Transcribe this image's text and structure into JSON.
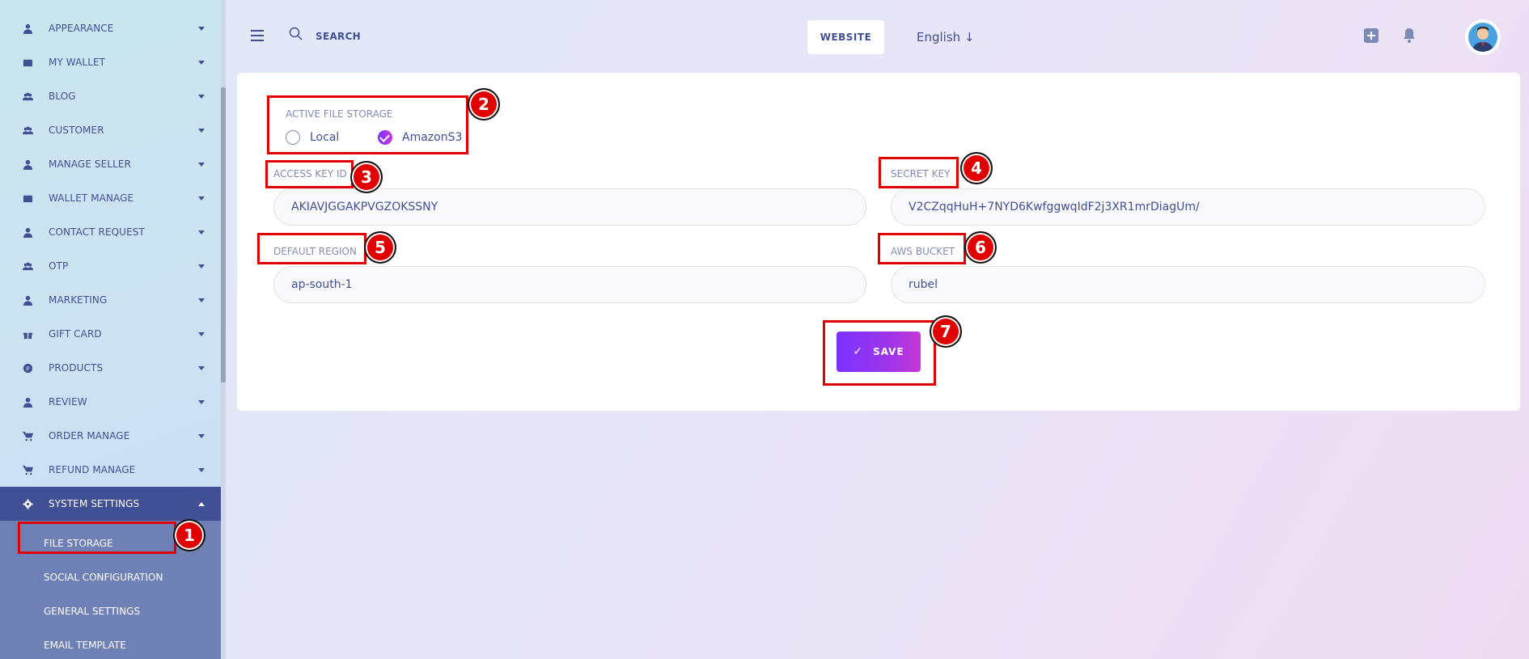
{
  "sidebar": {
    "items": [
      {
        "label": "APPEARANCE",
        "icon": "user-icon"
      },
      {
        "label": "MY WALLET",
        "icon": "wallet-icon"
      },
      {
        "label": "BLOG",
        "icon": "users-icon"
      },
      {
        "label": "CUSTOMER",
        "icon": "users-icon"
      },
      {
        "label": "MANAGE SELLER",
        "icon": "user-icon"
      },
      {
        "label": "WALLET MANAGE",
        "icon": "wallet-icon"
      },
      {
        "label": "CONTACT REQUEST",
        "icon": "user-icon"
      },
      {
        "label": "OTP",
        "icon": "users-icon"
      },
      {
        "label": "MARKETING",
        "icon": "user-icon"
      },
      {
        "label": "GIFT CARD",
        "icon": "gift-icon"
      },
      {
        "label": "PRODUCTS",
        "icon": "product-icon"
      },
      {
        "label": "REVIEW",
        "icon": "user-icon"
      },
      {
        "label": "ORDER MANAGE",
        "icon": "cart-icon"
      },
      {
        "label": "REFUND MANAGE",
        "icon": "cart-icon"
      },
      {
        "label": "SYSTEM SETTINGS",
        "icon": "gear-icon"
      }
    ],
    "sub_items": [
      "FILE STORAGE",
      "SOCIAL CONFIGURATION",
      "GENERAL SETTINGS",
      "EMAIL TEMPLATE"
    ]
  },
  "header": {
    "search_label": "SEARCH",
    "website_label": "WEBSITE",
    "language": "English"
  },
  "form": {
    "storage_label": "ACTIVE FILE STORAGE",
    "option_local": "Local",
    "option_s3": "AmazonS3",
    "access_key_label": "ACCESS KEY ID",
    "access_key_value": "AKIAVJGGAKPVGZOKSSNY",
    "secret_key_label": "SECRET KEY",
    "secret_key_value": "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",
    "region_label": "DEFAULT REGION",
    "region_value": "ap-south-1",
    "bucket_label": "AWS BUCKET",
    "bucket_value": "rubel",
    "save_label": "SAVE"
  },
  "annotations": [
    "1",
    "2",
    "3",
    "4",
    "5",
    "6",
    "7"
  ],
  "colors": {
    "accent": "#415094",
    "annotation": "#e00000",
    "button": "#7c32ff"
  }
}
